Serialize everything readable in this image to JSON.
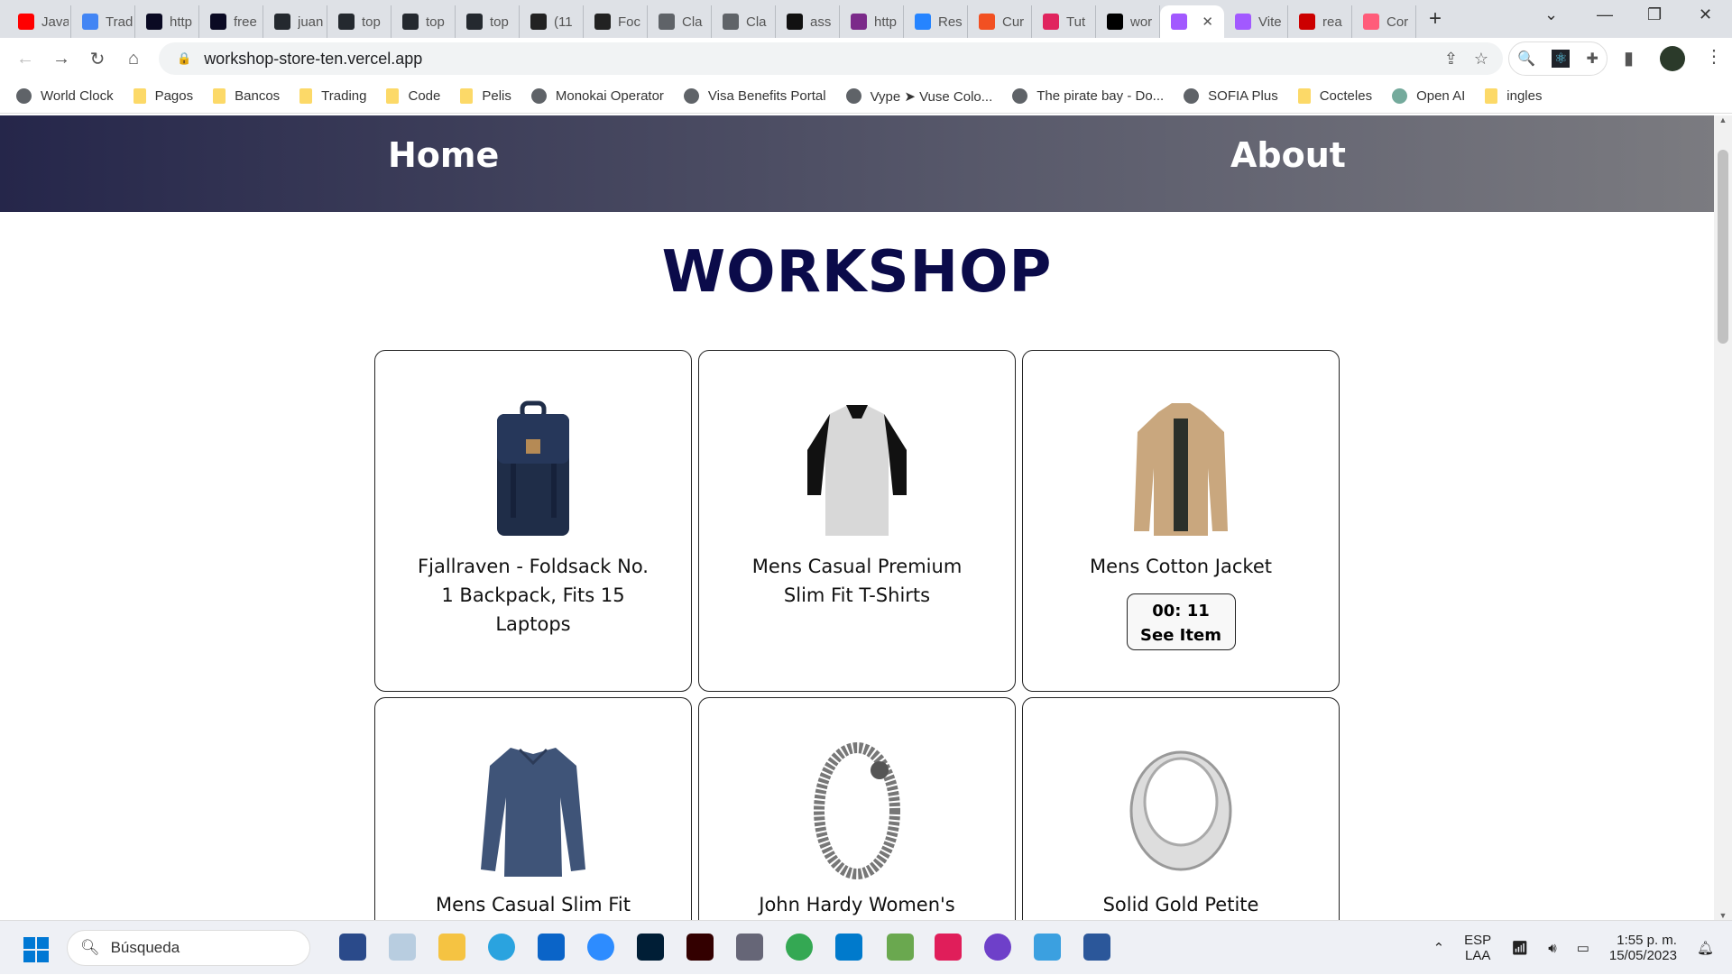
{
  "browser": {
    "tabs": [
      {
        "label": "Java",
        "color": "#ff0000"
      },
      {
        "label": "Trad",
        "color": "#4285f4"
      },
      {
        "label": "http",
        "color": "#0a0a23"
      },
      {
        "label": "free",
        "color": "#0a0a23"
      },
      {
        "label": "juan",
        "color": "#24292f"
      },
      {
        "label": "top",
        "color": "#24292f"
      },
      {
        "label": "top",
        "color": "#24292f"
      },
      {
        "label": "top",
        "color": "#24292f"
      },
      {
        "label": "(11",
        "color": "#222"
      },
      {
        "label": "Foc",
        "color": "#222"
      },
      {
        "label": "Cla",
        "color": "#5f6368"
      },
      {
        "label": "Cla",
        "color": "#5f6368"
      },
      {
        "label": "ass",
        "color": "#111"
      },
      {
        "label": "http",
        "color": "#7b2a8a"
      },
      {
        "label": "Res",
        "color": "#2684ff"
      },
      {
        "label": "Cur",
        "color": "#f25022"
      },
      {
        "label": "Tut",
        "color": "#e0245e"
      },
      {
        "label": "wor",
        "color": "#000"
      },
      {
        "label": "",
        "color": "#a259ff",
        "active": true
      },
      {
        "label": "Vite",
        "color": "#a259ff"
      },
      {
        "label": "rea",
        "color": "#cc0000"
      },
      {
        "label": "Cor",
        "color": "#ff5c7a"
      }
    ],
    "url": "workshop-store-ten.vercel.app",
    "bookmarks": [
      {
        "label": "World Clock",
        "type": "globe"
      },
      {
        "label": "Pagos",
        "type": "folder"
      },
      {
        "label": "Bancos",
        "type": "folder"
      },
      {
        "label": "Trading",
        "type": "folder"
      },
      {
        "label": "Code",
        "type": "folder"
      },
      {
        "label": "Pelis",
        "type": "folder"
      },
      {
        "label": "Monokai Operator",
        "type": "globe"
      },
      {
        "label": "Visa Benefits Portal",
        "type": "globe"
      },
      {
        "label": "Vype ➤ Vuse Colo...",
        "type": "globe"
      },
      {
        "label": "The pirate bay - Do...",
        "type": "globe"
      },
      {
        "label": "SOFIA Plus",
        "type": "globe"
      },
      {
        "label": "Cocteles",
        "type": "folder"
      },
      {
        "label": "Open AI",
        "type": "openai"
      },
      {
        "label": "ingles",
        "type": "folder"
      }
    ]
  },
  "site": {
    "nav": {
      "home": "Home",
      "about": "About"
    },
    "title": "WORKSHOP",
    "products": [
      {
        "title": "Fjallraven - Foldsack No. 1 Backpack, Fits 15 Laptops",
        "image": "backpack"
      },
      {
        "title": "Mens Casual Premium Slim Fit T-Shirts",
        "image": "tshirt"
      },
      {
        "title": "Mens Cotton Jacket",
        "image": "jacket",
        "timer": "00: 11",
        "button": "See Item"
      },
      {
        "title": "Mens Casual Slim Fit",
        "image": "longsleeve"
      },
      {
        "title": "John Hardy Women's",
        "image": "bracelet"
      },
      {
        "title": "Solid Gold Petite",
        "image": "ring"
      }
    ]
  },
  "taskbar": {
    "search_placeholder": "Búsqueda",
    "lang1": "ESP",
    "lang2": "LAA",
    "time": "1:55 p. m.",
    "date": "15/05/2023"
  }
}
